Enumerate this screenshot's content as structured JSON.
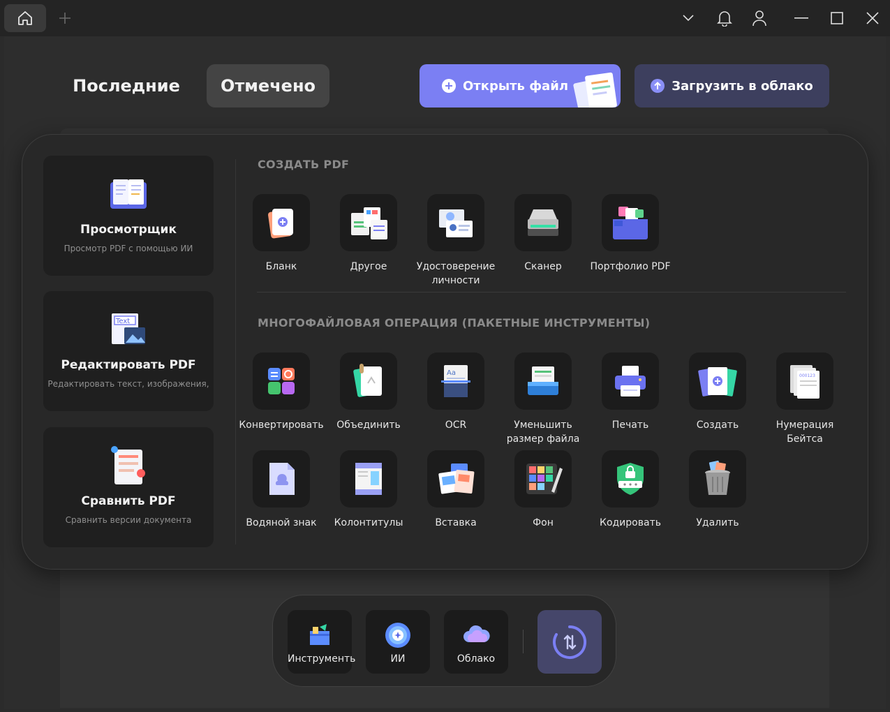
{
  "tabs": {
    "recent": "Последние",
    "marked": "Отмечено"
  },
  "actions": {
    "open_file": "Открыть файл",
    "upload_cloud": "Загрузить в облако"
  },
  "features": [
    {
      "title": "Просмотрщик",
      "subtitle": "Просмотр PDF с помощью ИИ"
    },
    {
      "title": "Редактировать PDF",
      "subtitle": "Редактировать текст, изображения,"
    },
    {
      "title": "Сравнить PDF",
      "subtitle": "Сравнить версии документа"
    }
  ],
  "sections": {
    "create": "СОЗДАТЬ PDF",
    "batch": "МНОГОФАЙЛОВАЯ ОПЕРАЦИЯ (ПАКЕТНЫЕ ИНСТРУМЕНТЫ)"
  },
  "create_tools": [
    {
      "label": "Бланк",
      "icon": "blank-page-icon"
    },
    {
      "label": "Другое",
      "icon": "other-files-icon"
    },
    {
      "label": "Удостоверение личности",
      "icon": "id-card-icon"
    },
    {
      "label": "Сканер",
      "icon": "scanner-icon"
    },
    {
      "label": "Портфолио PDF",
      "icon": "portfolio-icon"
    }
  ],
  "batch_tools": [
    {
      "label": "Конвертировать",
      "icon": "convert-icon"
    },
    {
      "label": "Объединить",
      "icon": "merge-icon"
    },
    {
      "label": "OCR",
      "icon": "ocr-icon"
    },
    {
      "label": "Уменьшить размер файла",
      "icon": "compress-icon"
    },
    {
      "label": "Печать",
      "icon": "print-icon"
    },
    {
      "label": "Создать",
      "icon": "create-icon"
    },
    {
      "label": "Нумерация Бейтса",
      "icon": "bates-numbering-icon"
    },
    {
      "label": "Водяной знак",
      "icon": "watermark-icon"
    },
    {
      "label": "Колонтитулы",
      "icon": "header-footer-icon"
    },
    {
      "label": "Вставка",
      "icon": "insert-icon"
    },
    {
      "label": "Фон",
      "icon": "background-icon"
    },
    {
      "label": "Кодировать",
      "icon": "encrypt-icon"
    },
    {
      "label": "Удалить",
      "icon": "delete-icon"
    }
  ],
  "dock": [
    {
      "label": "Инструменть",
      "icon": "tools-icon"
    },
    {
      "label": "ИИ",
      "icon": "ai-icon"
    },
    {
      "label": "Облако",
      "icon": "cloud-icon"
    }
  ],
  "colors": {
    "accent": "#7b7ff3",
    "upload_bg": "#3d3f5e",
    "dock_active": "#45466a"
  }
}
